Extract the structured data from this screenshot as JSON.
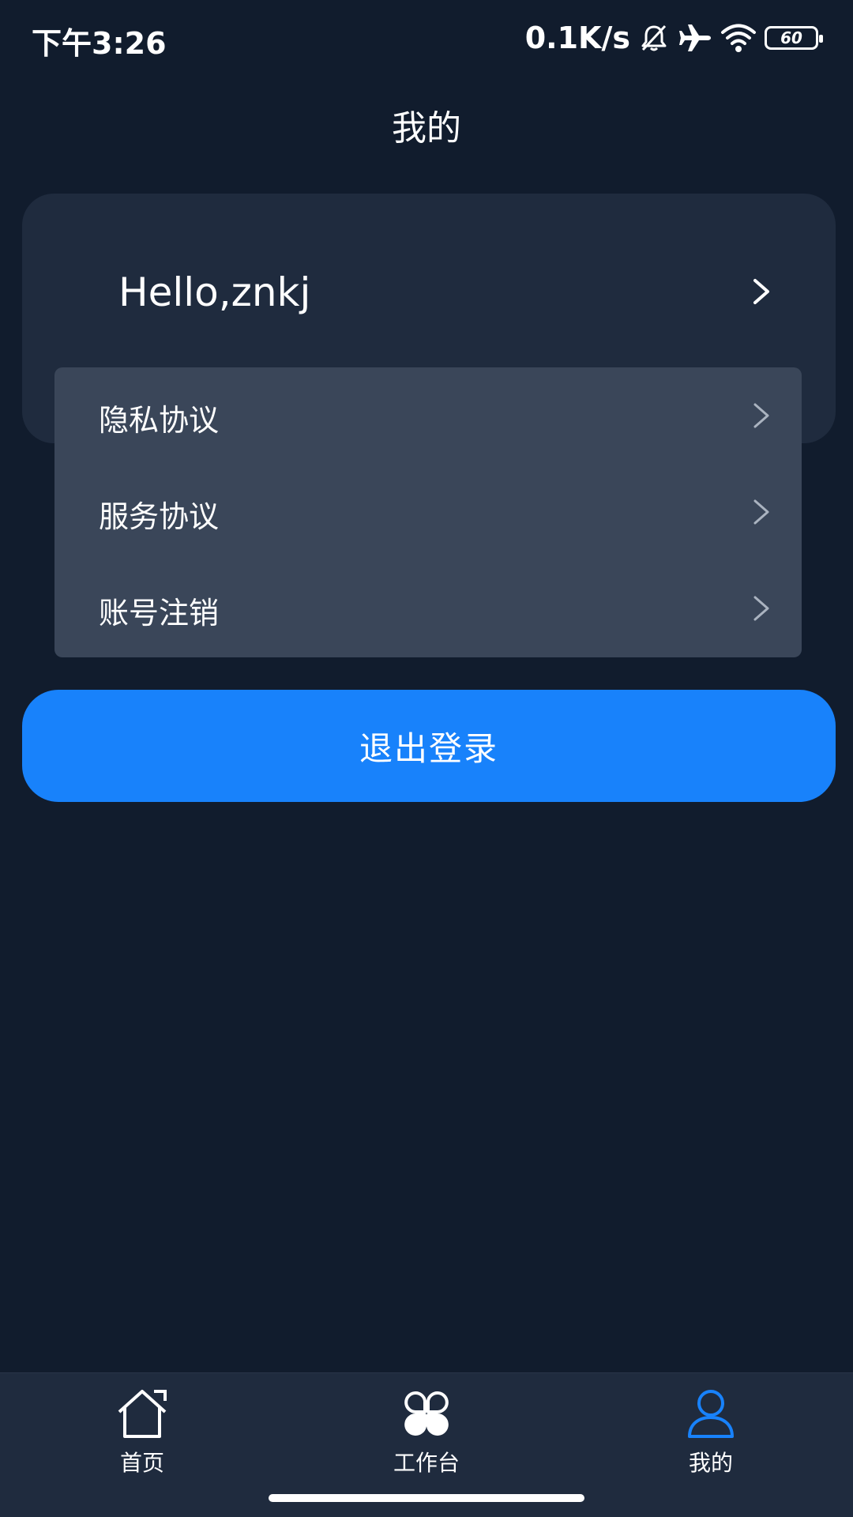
{
  "status_bar": {
    "time": "下午3:26",
    "net_speed": "0.1K/s",
    "battery_level": "60",
    "icons": [
      "bell-off-icon",
      "airplane-icon",
      "wifi-icon",
      "battery-icon"
    ]
  },
  "header": {
    "title": "我的"
  },
  "profile": {
    "greeting": "Hello,znkj"
  },
  "menu": {
    "items": [
      {
        "label": "隐私协议"
      },
      {
        "label": "服务协议"
      },
      {
        "label": "账号注销"
      }
    ]
  },
  "logout": {
    "label": "退出登录"
  },
  "bottom_nav": {
    "items": [
      {
        "label": "首页",
        "icon": "home-icon"
      },
      {
        "label": "工作台",
        "icon": "workbench-icon"
      },
      {
        "label": "我的",
        "icon": "user-icon",
        "active": true
      }
    ]
  },
  "colors": {
    "background": "#111c2d",
    "card": "#1f2b3e",
    "menu_card": "#3a4659",
    "accent": "#1882fb"
  }
}
